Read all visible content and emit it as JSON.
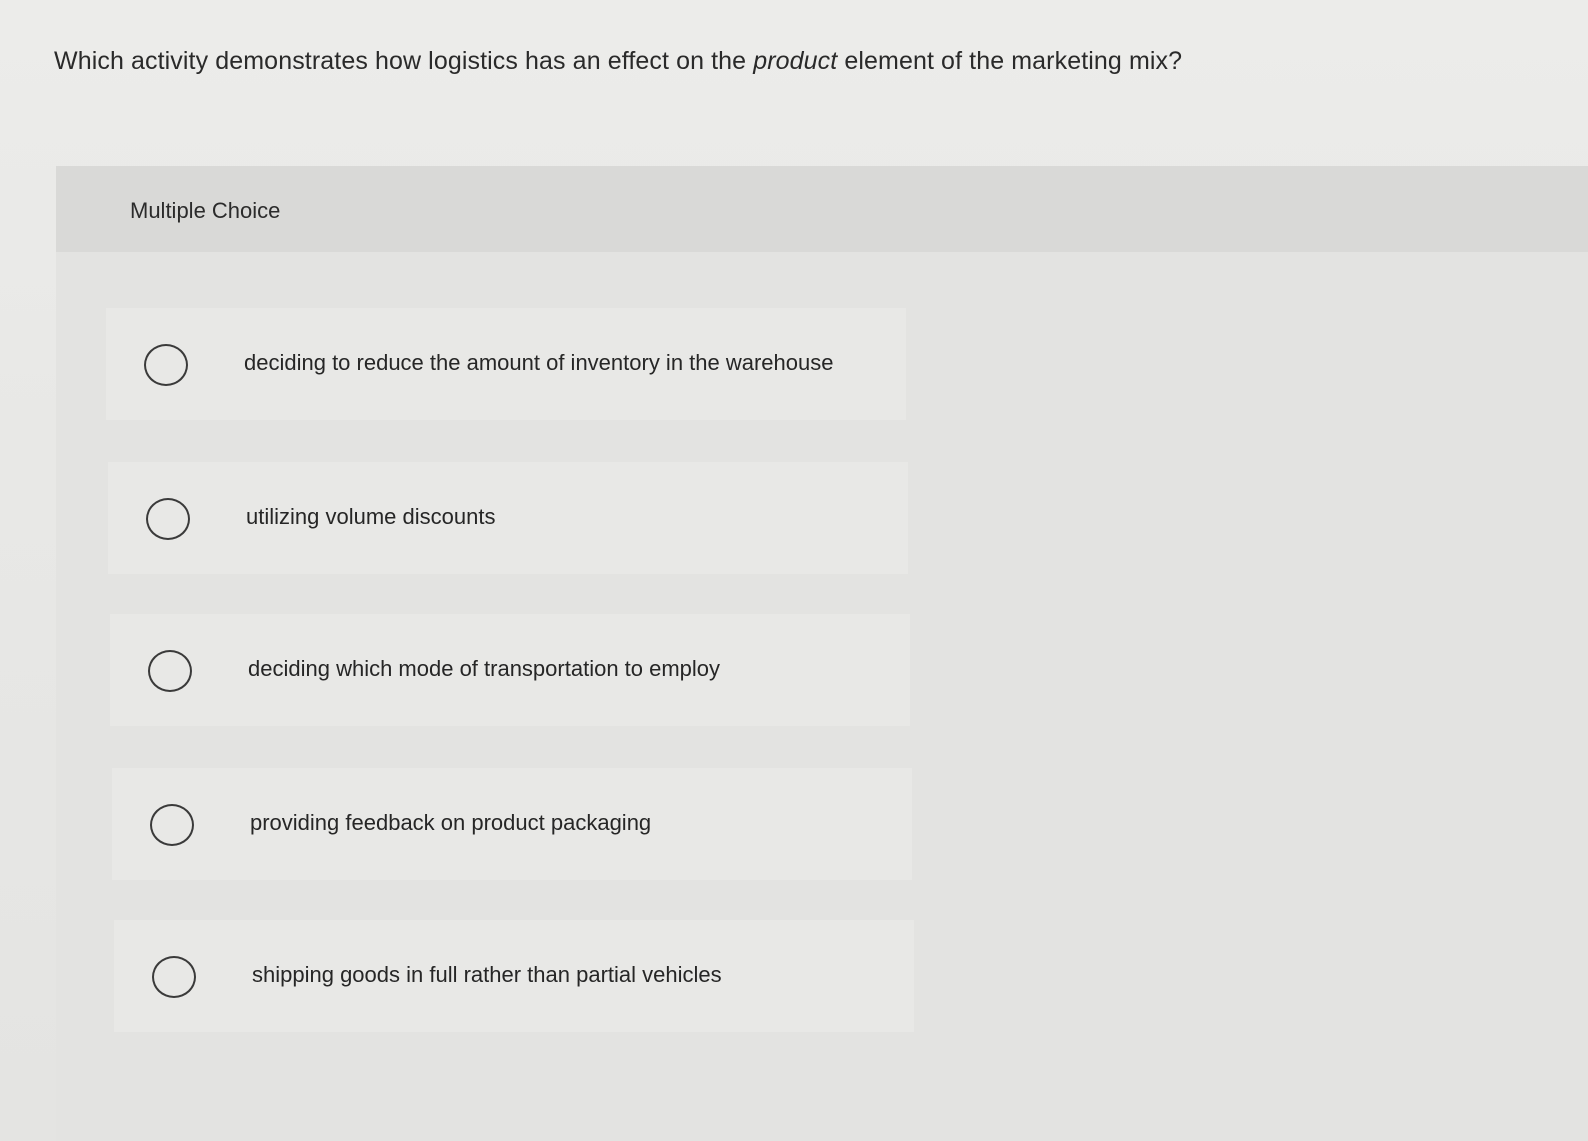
{
  "question": {
    "prefix": "Which activity demonstrates how logistics has an effect on the ",
    "emphasis": "product",
    "suffix": " element of the marketing mix?"
  },
  "multiple_choice": {
    "label": "Multiple Choice",
    "options": [
      {
        "label": "deciding to reduce the amount of inventory in the warehouse",
        "selected": false
      },
      {
        "label": "utilizing volume discounts",
        "selected": false
      },
      {
        "label": "deciding which mode of transportation to employ",
        "selected": false
      },
      {
        "label": "providing feedback on product packaging",
        "selected": false
      },
      {
        "label": "shipping goods in full rather than partial vehicles",
        "selected": false
      }
    ]
  }
}
